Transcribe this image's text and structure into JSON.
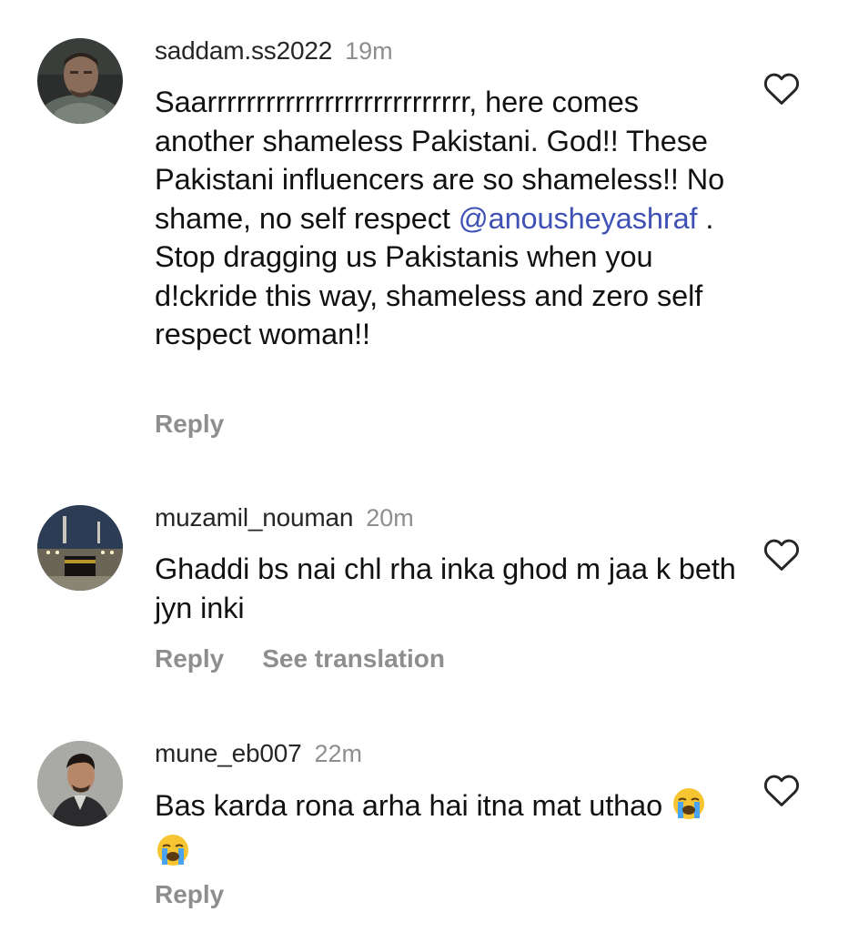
{
  "comments": [
    {
      "username": "saddam.ss2022",
      "time": "19m",
      "text_before_mention": "Saarrrrrrrrrrrrrrrrrrrrrrrrrrr, here comes another shameless Pakistani. God!! These Pakistani influencers are so shameless!! No shame, no self respect ",
      "mention": "@anousheyashraf",
      "text_after_mention": " . Stop dragging us Pakistanis when you d!ckride this way, shameless and zero self respect woman!!",
      "reply_label": "Reply"
    },
    {
      "username": "muzamil_nouman",
      "time": "20m",
      "text": "Ghaddi bs nai chl rha inka ghod m jaa k beth jyn inki",
      "reply_label": "Reply",
      "translation_label": "See translation"
    },
    {
      "username": "mune_eb007",
      "time": "22m",
      "text": "Bas karda rona arha hai itna mat uthao",
      "emoji_text": "😭😭",
      "reply_label": "Reply"
    }
  ],
  "icons": {
    "like": "heart-outline-icon",
    "cry_emoji": "loudly-crying-face-emoji"
  },
  "colors": {
    "mention": "#3f51b5",
    "muted": "#8e8e8e",
    "text": "#111111"
  }
}
